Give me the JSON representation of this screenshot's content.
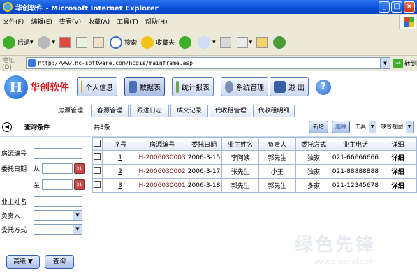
{
  "window": {
    "title": "华创软件 - Microsoft Internet Explorer",
    "minimize": "_",
    "maximize": "□",
    "close": "×"
  },
  "menu": [
    "文件(F)",
    "编辑(E)",
    "查看(V)",
    "收藏(A)",
    "工具(T)",
    "帮助(H)"
  ],
  "toolbar": {
    "back": "后退",
    "search": "搜索",
    "favorites": "收藏夹"
  },
  "address": {
    "label": "地址(D)",
    "url": "http://www.hc-software.com/hcgis/mainframe.asp",
    "go": "转到"
  },
  "app": {
    "logo_text": "华创软件",
    "logo_mark": "H",
    "nav": [
      "个人信息",
      "数据表",
      "统计报表",
      "系统管理",
      "退 出"
    ],
    "active_nav": "数据表",
    "help": "?"
  },
  "tabs": [
    "房源管理",
    "客源管理",
    "跟进日志",
    "成交记录",
    "代收租管理",
    "代收租明细"
  ],
  "search_panel": {
    "title": "查询条件",
    "fields": {
      "house_no": "房源编号",
      "commission_date": "委托日期",
      "from": "从",
      "to": "至",
      "owner_name": "业主姓名",
      "person_in_charge": "负责人",
      "commission_type": "委托方式"
    },
    "advanced_button": "高级 ▼",
    "search_button": "查询"
  },
  "main": {
    "total": "共3条",
    "buttons": {
      "add": "新增",
      "delete": "删除"
    },
    "tools_select": "工具",
    "view_select": "缺省视图",
    "columns": [
      "序号",
      "房源编号",
      "委托日期",
      "业主姓名",
      "负责人",
      "委托方式",
      "业主电话",
      "详细"
    ],
    "rows": [
      {
        "no": "1",
        "code": "H-2006030003",
        "date": "2006-3-15",
        "owner": "李阿姨",
        "agent": "郭先生",
        "type": "独家",
        "phone": "021-66666666",
        "detail": "详细"
      },
      {
        "no": "2",
        "code": "H-2006030002",
        "date": "2006-3-17",
        "owner": "张先生",
        "agent": "小王",
        "type": "独家",
        "phone": "021-88888888",
        "detail": "详细"
      },
      {
        "no": "3",
        "code": "H-2006030001",
        "date": "2006-3-18",
        "owner": "郭先生",
        "agent": "郭先生",
        "type": "多家",
        "phone": "021-12345678",
        "detail": "详细"
      }
    ]
  },
  "watermark": {
    "text": "绿色先锋",
    "url": "www.greenxf.com"
  }
}
